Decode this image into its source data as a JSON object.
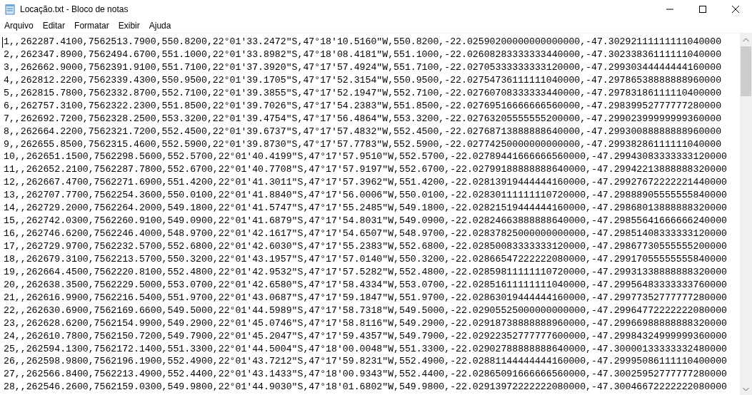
{
  "window": {
    "title": "Locação.txt - Bloco de notas"
  },
  "menu": [
    "Arquivo",
    "Editar",
    "Formatar",
    "Exibir",
    "Ajuda"
  ],
  "lines": [
    "1,,262287.4100,7562513.7900,550.8200,22°01'33.2472\"S,47°18'10.5160\"W,550.8200,-22.02590200000000000000,-47.30292111111111040000",
    "2,,262347.8900,7562494.6700,551.1000,22°01'33.8982\"S,47°18'08.4181\"W,551.1000,-22.02608283333333440000,-47.30233836111111040000",
    "3,,262662.9000,7562391.9100,551.7100,22°01'37.3920\"S,47°17'57.4924\"W,551.7100,-22.02705333333333120000,-47.29930344444444160000",
    "4,,262812.2200,7562339.4300,550.9500,22°01'39.1705\"S,47°17'52.3154\"W,550.9500,-22.02754736111111040000,-47.29786538888888960000",
    "5,,262815.7800,7562332.8700,552.7100,22°01'39.3855\"S,47°17'52.1947\"W,552.7100,-22.02760708333333440000,-47.29783186111110400000",
    "6,,262757.3100,7562322.2300,551.8500,22°01'39.7026\"S,47°17'54.2383\"W,551.8500,-22.02769516666666560000,-47.29839952777777280000",
    "7,,262692.7200,7562328.2500,553.3200,22°01'39.4754\"S,47°17'56.4864\"W,553.3200,-22.02763205555555200000,-47.29902399999999360000",
    "8,,262664.2200,7562321.7200,552.4500,22°01'39.6737\"S,47°17'57.4832\"W,552.4500,-22.02768713888888640000,-47.29930088888888960000",
    "9,,262655.8500,7562315.4600,552.5900,22°01'39.8730\"S,47°17'57.7783\"W,552.5900,-22.02774250000000000000,-47.29938286111111040000",
    "10,,262651.1500,7562298.5600,552.5700,22°01'40.4199\"S,47°17'57.9510\"W,552.5700,-22.02789441666666560000,-47.29943083333333120000",
    "11,,262652.2100,7562287.7800,552.6700,22°01'40.7708\"S,47°17'57.9197\"W,552.6700,-22.02799188888888640000,-47.29942213888888320000",
    "12,,262667.4700,7562271.6900,551.4200,22°01'41.3011\"S,47°17'57.3962\"W,551.4200,-22.02813919444444160000,-47.29927672222221440000",
    "13,,262707.7700,7562254.3600,550.0100,22°01'41.8840\"S,47°17'56.0006\"W,550.0100,-22.02830111111110720000,-47.29888905555555840000",
    "14,,262729.2000,7562264.2000,549.1800,22°01'41.5747\"S,47°17'55.2485\"W,549.1800,-22.02821519444444160000,-47.29868013888888320000",
    "15,,262742.0300,7562260.9100,549.0900,22°01'41.6879\"S,47°17'54.8031\"W,549.0900,-22.02824663888888640000,-47.29855641666666240000",
    "16,,262746.6200,7562246.4000,548.9700,22°01'42.1617\"S,47°17'54.6507\"W,548.9700,-22.02837825000000000000,-47.29851408333333120000",
    "17,,262729.9700,7562232.5700,552.6800,22°01'42.6030\"S,47°17'55.2383\"W,552.6800,-22.02850083333333120000,-47.29867730555555200000",
    "18,,262679.3100,7562213.5700,550.3200,22°01'43.1957\"S,47°17'57.0140\"W,550.3200,-22.02866547222222080000,-47.29917055555555840000",
    "19,,262664.4500,7562220.8100,552.4800,22°01'42.9532\"S,47°17'57.5282\"W,552.4800,-22.02859811111110720000,-47.29931338888888320000",
    "20,,262638.3500,7562229.5000,553.0700,22°01'42.6580\"S,47°17'58.4334\"W,553.0700,-22.02851611111111040000,-47.29956483333333760000",
    "21,,262616.9900,7562216.5400,551.9700,22°01'43.0687\"S,47°17'59.1847\"W,551.9700,-22.02863019444444160000,-47.29977352777777280000",
    "22,,262630.6900,7562169.6600,549.5000,22°01'44.5989\"S,47°17'58.7318\"W,549.5000,-22.02905525000000000000,-47.29964772222222080000",
    "23,,262628.6200,7562154.9900,549.2900,22°01'45.0746\"S,47°17'58.8116\"W,549.2900,-22.02918738888888960000,-47.29966988888888320000",
    "24,,262610.7800,7562150.7200,549.7900,22°01'45.2047\"S,47°17'59.4357\"W,549.7900,-22.02922352777777600000,-47.29984324999999360000",
    "25,,262594.1300,7562172.1400,551.3300,22°01'44.5004\"S,47°18'00.0048\"W,551.3300,-22.02902788888888640000,-47.30000133333332480000",
    "26,,262598.9800,7562196.1900,552.4900,22°01'43.7212\"S,47°17'59.8231\"W,552.4900,-22.02881144444444160000,-47.29995086111110400000",
    "27,,262566.8400,7562213.4900,552.4400,22°01'43.1433\"S,47°18'00.9343\"W,552.4400,-22.02865091666666560000,-47.30025952777777280000",
    "28,,262546.2600,7562159.0300,549.9800,22°01'44.9030\"S,47°18'01.6802\"W,549.9800,-22.02913972222222080000,-47.30046672222222080000"
  ]
}
